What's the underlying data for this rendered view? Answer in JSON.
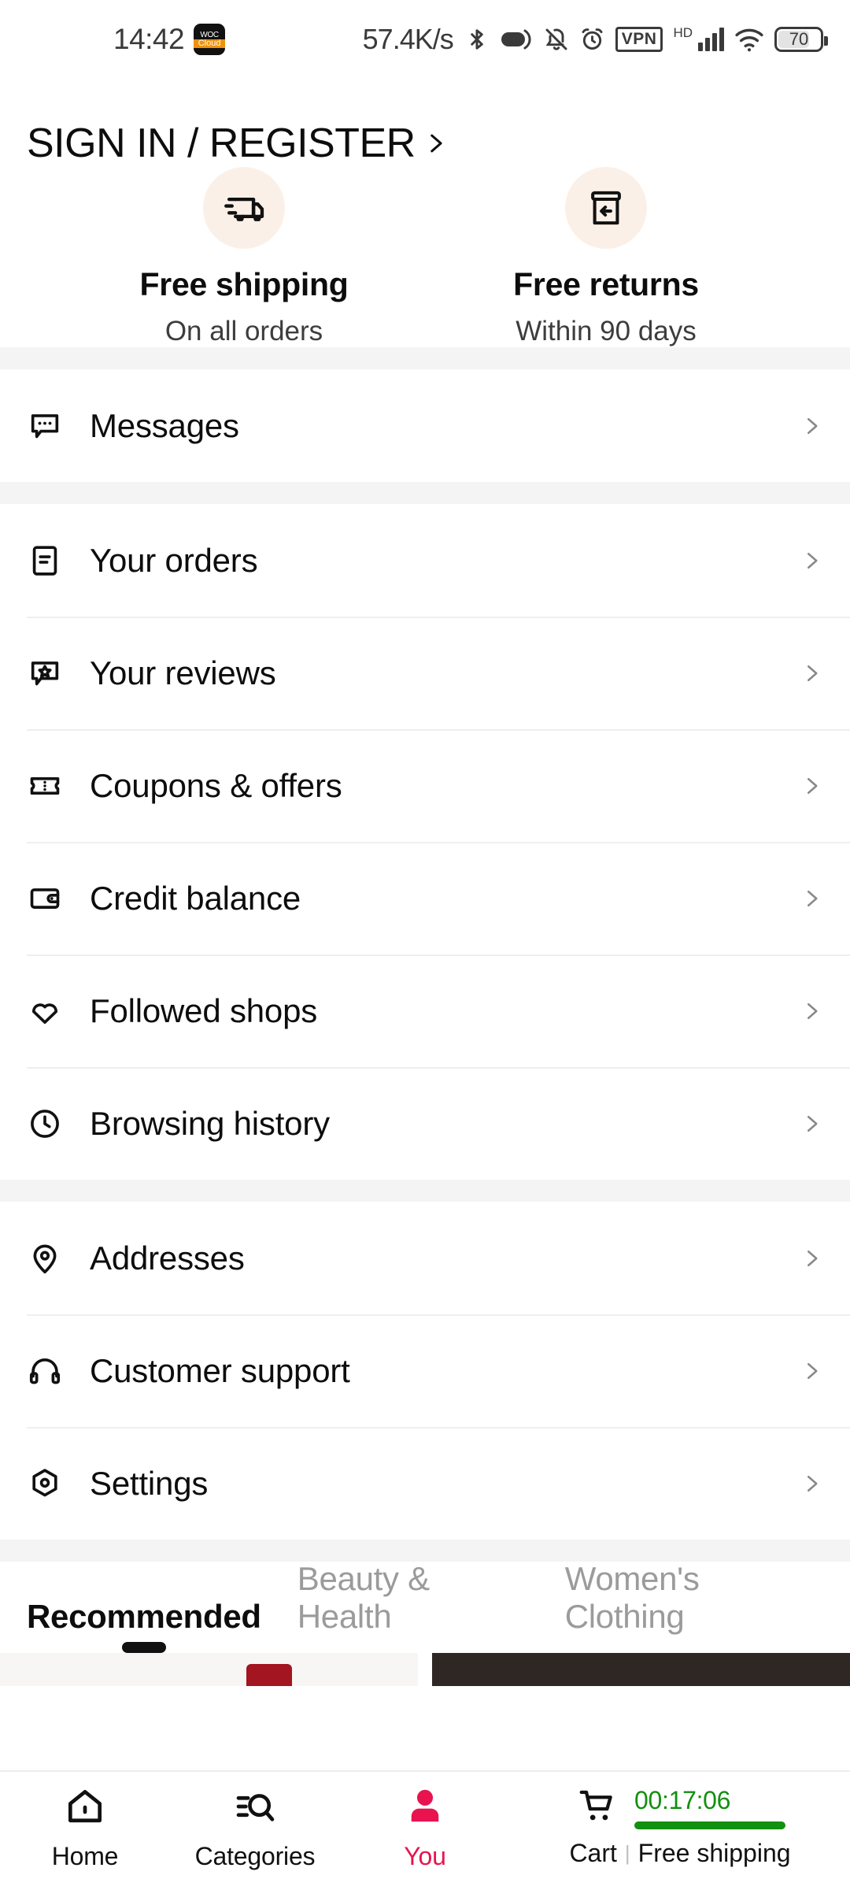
{
  "status_bar": {
    "time": "14:42",
    "badge_top": "WOC",
    "badge_bottom": "Cloud",
    "network_speed": "57.4K/s",
    "vpn_label": "VPN",
    "hd_label": "HD",
    "battery_level": "70",
    "icons": [
      "bluetooth-icon",
      "ring-mode-icon",
      "mute-bell-icon",
      "alarm-icon",
      "vpn-icon",
      "signal-bars-icon",
      "wifi-icon",
      "battery-icon"
    ]
  },
  "header": {
    "sign_in_label": "SIGN IN / REGISTER",
    "chevron": "chevron-right-icon"
  },
  "benefits": [
    {
      "icon": "delivery-truck-icon",
      "title": "Free shipping",
      "subtitle": "On all orders"
    },
    {
      "icon": "return-box-icon",
      "title": "Free returns",
      "subtitle": "Within 90 days"
    }
  ],
  "menu_groups": [
    {
      "items": [
        {
          "icon": "message-bubble-icon",
          "label": "Messages"
        }
      ]
    },
    {
      "items": [
        {
          "icon": "order-document-icon",
          "label": "Your orders"
        },
        {
          "icon": "review-star-bubble-icon",
          "label": "Your reviews"
        },
        {
          "icon": "coupon-ticket-icon",
          "label": "Coupons & offers"
        },
        {
          "icon": "wallet-icon",
          "label": "Credit balance"
        },
        {
          "icon": "heart-icon",
          "label": "Followed shops"
        },
        {
          "icon": "clock-history-icon",
          "label": "Browsing history"
        }
      ]
    },
    {
      "items": [
        {
          "icon": "map-pin-icon",
          "label": "Addresses"
        },
        {
          "icon": "headphones-icon",
          "label": "Customer support"
        },
        {
          "icon": "settings-hexagon-icon",
          "label": "Settings"
        }
      ]
    }
  ],
  "tabs": [
    {
      "label": "Recommended",
      "active": true
    },
    {
      "label": "Beauty & Health",
      "active": false
    },
    {
      "label": "Women's Clothing",
      "active": false
    }
  ],
  "bottom_nav": {
    "items": [
      {
        "icon": "home-icon",
        "label": "Home",
        "active": false
      },
      {
        "icon": "categories-search-icon",
        "label": "Categories",
        "active": false
      },
      {
        "icon": "person-icon",
        "label": "You",
        "active": true
      }
    ],
    "cart": {
      "icon": "shopping-cart-icon",
      "timer": "00:17:06",
      "label": "Cart",
      "separator": "|",
      "promo": "Free shipping"
    }
  },
  "colors": {
    "accent_pink": "#e8134f",
    "timer_green": "#12900f",
    "benefit_circle": "#fbf0e7",
    "divider_gray": "#f4f4f4",
    "muted_text": "#9b9b9b"
  }
}
